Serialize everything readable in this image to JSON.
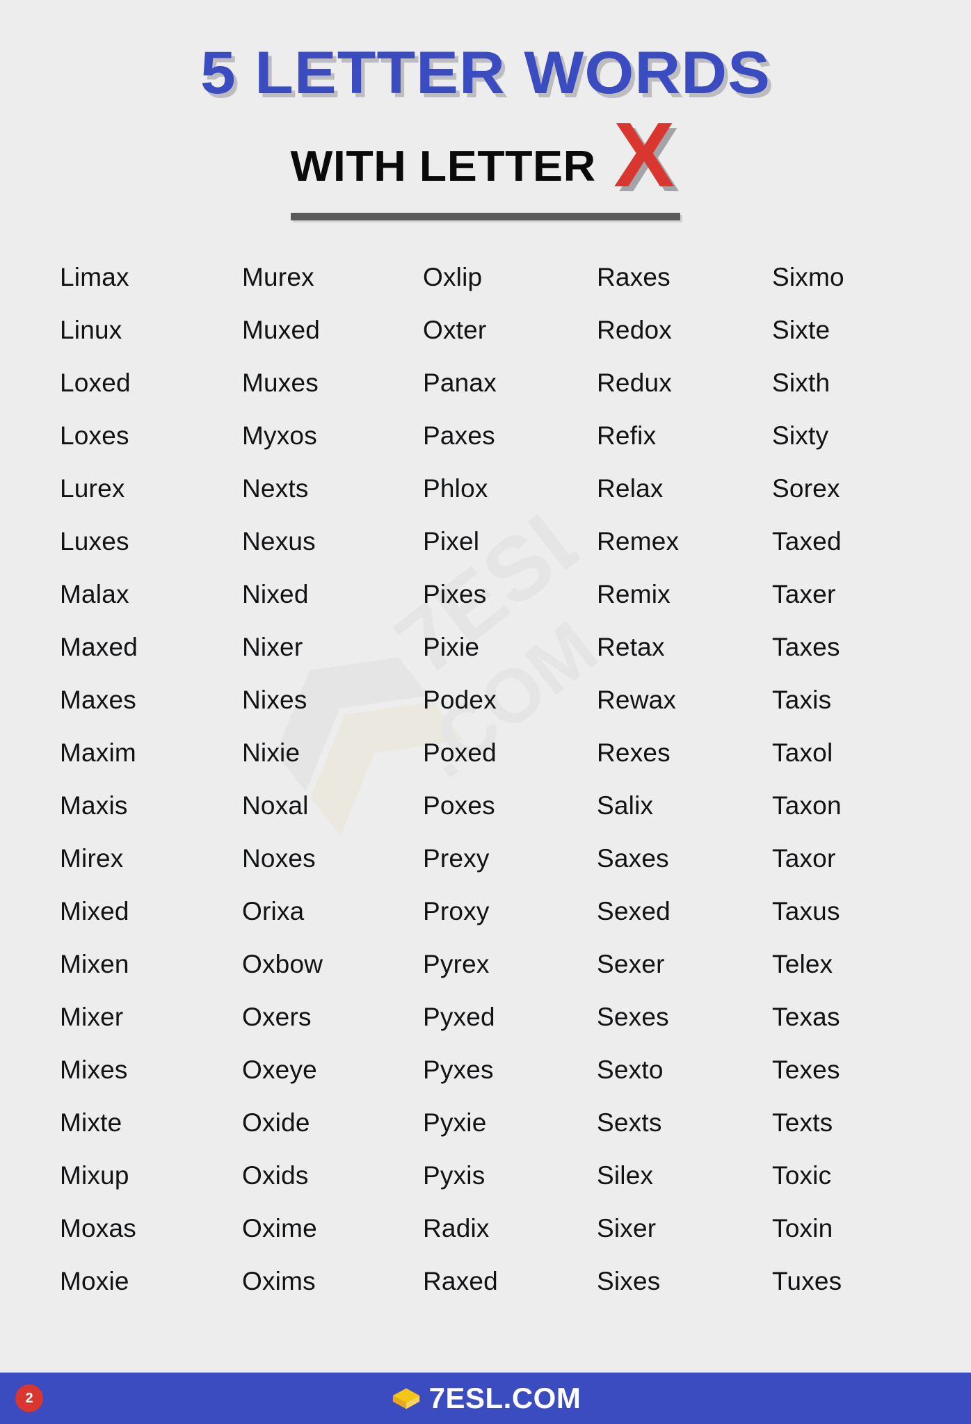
{
  "header": {
    "title": "5 LETTER WORDS",
    "subtitle": "WITH LETTER",
    "highlight_letter": "X",
    "title_color": "#3b4cc0",
    "letter_color": "#d8362f"
  },
  "columns": [
    {
      "words": [
        "Limax",
        "Linux",
        "Loxed",
        "Loxes",
        "Lurex",
        "Luxes",
        "Malax",
        "Maxed",
        "Maxes",
        "Maxim",
        "Maxis",
        "Mirex",
        "Mixed",
        "Mixen",
        "Mixer",
        "Mixes",
        "Mixte",
        "Mixup",
        "Moxas",
        "Moxie"
      ]
    },
    {
      "words": [
        "Murex",
        "Muxed",
        "Muxes",
        "Myxos",
        "Nexts",
        "Nexus",
        "Nixed",
        "Nixer",
        "Nixes",
        "Nixie",
        "Noxal",
        "Noxes",
        "Orixa",
        "Oxbow",
        "Oxers",
        "Oxeye",
        "Oxide",
        "Oxids",
        "Oxime",
        "Oxims"
      ]
    },
    {
      "words": [
        "Oxlip",
        "Oxter",
        "Panax",
        "Paxes",
        "Phlox",
        "Pixel",
        "Pixes",
        "Pixie",
        "Podex",
        "Poxed",
        "Poxes",
        "Prexy",
        "Proxy",
        "Pyrex",
        "Pyxed",
        "Pyxes",
        "Pyxie",
        "Pyxis",
        "Radix",
        "Raxed"
      ]
    },
    {
      "words": [
        "Raxes",
        "Redox",
        "Redux",
        "Refix",
        "Relax",
        "Remex",
        "Remix",
        "Retax",
        "Rewax",
        "Rexes",
        "Salix",
        "Saxes",
        "Sexed",
        "Sexer",
        "Sexes",
        "Sexto",
        "Sexts",
        "Silex",
        "Sixer",
        "Sixes"
      ]
    },
    {
      "words": [
        "Sixmo",
        "Sixte",
        "Sixth",
        "Sixty",
        "Sorex",
        "Taxed",
        "Taxer",
        "Taxes",
        "Taxis",
        "Taxol",
        "Taxon",
        "Taxor",
        "Taxus",
        "Telex",
        "Texas",
        "Texes",
        "Texts",
        "Toxic",
        "Toxin",
        "Tuxes"
      ]
    }
  ],
  "footer": {
    "page_number": "2",
    "brand_text": "7ESL.COM",
    "brand_icon": "graduation-cap-icon",
    "bar_color": "#3b4cc0",
    "badge_color": "#d8362f"
  }
}
